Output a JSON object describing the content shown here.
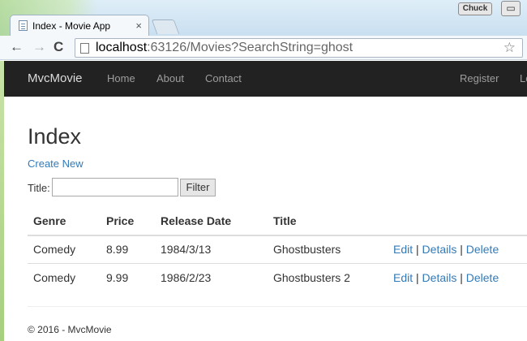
{
  "browser": {
    "tab_title": "Index - Movie App",
    "tab_close": "×",
    "user_name": "Chuck",
    "url_host": "localhost",
    "url_rest": ":63126/Movies?SearchString=ghost",
    "back": "←",
    "forward": "→",
    "reload": "C",
    "minimize": "▭",
    "star": "☆"
  },
  "navbar": {
    "brand": "MvcMovie",
    "links": [
      "Home",
      "About",
      "Contact"
    ],
    "right_links": [
      "Register",
      "Log in"
    ]
  },
  "page": {
    "title": "Index",
    "create_new": "Create New",
    "filter_label": "Title:",
    "filter_value": "",
    "filter_button": "Filter"
  },
  "table": {
    "headers": [
      "Genre",
      "Price",
      "Release Date",
      "Title"
    ],
    "rows": [
      {
        "genre": "Comedy",
        "price": "8.99",
        "release_date": "1984/3/13",
        "title": "Ghostbusters"
      },
      {
        "genre": "Comedy",
        "price": "9.99",
        "release_date": "1986/2/23",
        "title": "Ghostbusters 2"
      }
    ],
    "action_edit": "Edit",
    "action_details": "Details",
    "action_delete": "Delete",
    "separator": "|"
  },
  "footer": {
    "text": "© 2016 - MvcMovie"
  }
}
